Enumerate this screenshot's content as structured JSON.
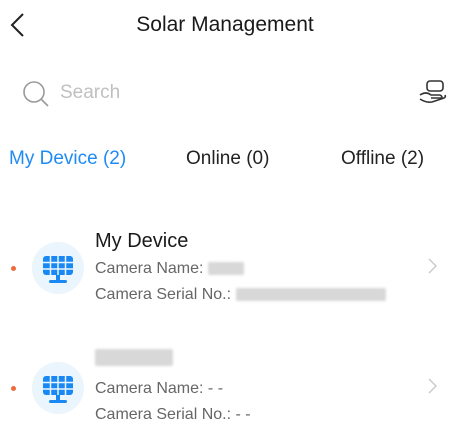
{
  "header": {
    "title": "Solar Management",
    "back_icon": "chevron-left-icon"
  },
  "search": {
    "placeholder": "Search",
    "value": "",
    "icon": "search-icon",
    "action_icon": "hand-device-icon"
  },
  "tabs": [
    {
      "label": "My Device (2)",
      "active": true
    },
    {
      "label": "Online (0)",
      "active": false
    },
    {
      "label": "Offline (2)",
      "active": false
    }
  ],
  "devices": [
    {
      "name": "My Device",
      "camera_name_label": "Camera Name: ",
      "camera_serial_label": "Camera Serial No.: ",
      "status_color": "#f06a3c"
    },
    {
      "camera_name_label": "Camera Name: - -",
      "camera_serial_label": "Camera Serial No.: - -",
      "status_color": "#f06a3c"
    }
  ],
  "colors": {
    "accent": "#1e8bf5",
    "icon_blue": "#1a88f2",
    "status_offline": "#f06a3c"
  }
}
